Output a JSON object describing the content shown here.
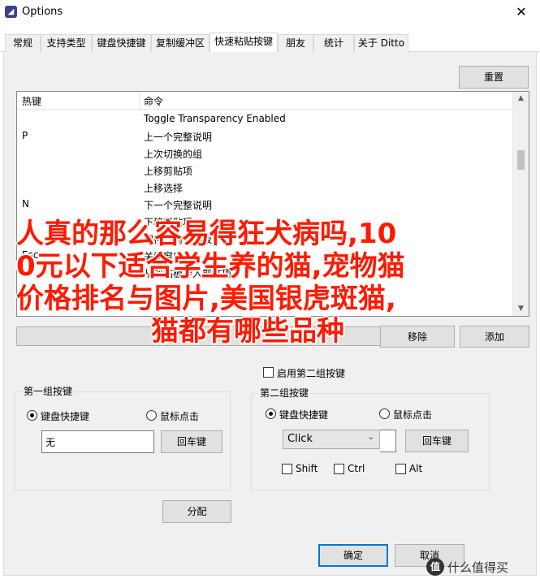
{
  "window": {
    "title": "Options",
    "close_glyph": "✕",
    "app_icon_glyph": "◢"
  },
  "tabs": [
    {
      "label": "常规"
    },
    {
      "label": "支持类型"
    },
    {
      "label": "键盘快捷键"
    },
    {
      "label": "复制缓冲区"
    },
    {
      "label": "快速粘贴按键",
      "active": true
    },
    {
      "label": "朋友"
    },
    {
      "label": "统计"
    },
    {
      "label": "关于 Ditto"
    }
  ],
  "reset_button": "重置",
  "table": {
    "headers": {
      "key": "热键",
      "command": "命令"
    },
    "rows": [
      {
        "key": "",
        "command": "Toggle Transparency Enabled"
      },
      {
        "key": "P",
        "command": "上一个完整说明"
      },
      {
        "key": "",
        "command": "上次切换的组"
      },
      {
        "key": "",
        "command": "上移剪贴项"
      },
      {
        "key": "",
        "command": "上移选择"
      },
      {
        "key": "N",
        "command": "下一个完整说明"
      },
      {
        "key": "",
        "command": "下移剪贴项"
      },
      {
        "key": "",
        "command": "保存当前剪贴板"
      },
      {
        "key": "Esc",
        "command": "关闭窗口"
      },
      {
        "key": "",
        "command": "从剪贴板导入剪贴项"
      }
    ],
    "scroll_up_glyph": "▲",
    "scroll_down_glyph": "▼"
  },
  "actions": {
    "remove": "移除",
    "add": "添加"
  },
  "second_group_toggle": "启用第二组按键",
  "group1": {
    "title": "第一组按键",
    "radio_keyboard": "键盘快捷键",
    "radio_mouse": "鼠标点击",
    "selected": "keyboard",
    "hotkey_value": "无",
    "enter_button": "回车键"
  },
  "group2": {
    "title": "第二组按键",
    "radio_keyboard": "键盘快捷键",
    "radio_mouse": "鼠标点击",
    "selected": "keyboard",
    "mouse_option": "Click",
    "enter_button": "回车键",
    "mod_shift": "Shift",
    "mod_ctrl": "Ctrl",
    "mod_alt": "Alt"
  },
  "assign_button": "分配",
  "ok_button": "确定",
  "cancel_button": "取消",
  "overlay_text": [
    "人真的那么容易得狂犬病吗,10",
    "0元以下适合学生养的猫,宠物猫",
    "价格排名与图片,美国银虎斑猫,",
    "猫都有哪些品种"
  ],
  "watermark": {
    "logo_glyph": "值",
    "text": "什么值得买"
  }
}
